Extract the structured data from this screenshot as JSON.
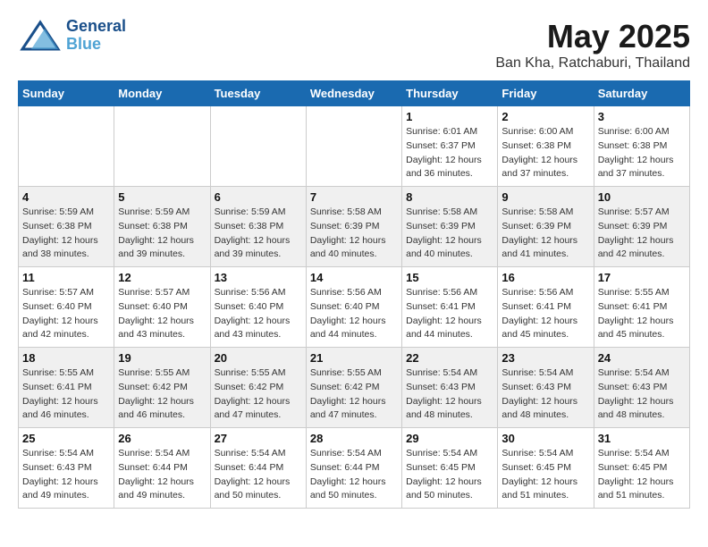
{
  "header": {
    "logo_general": "General",
    "logo_blue": "Blue",
    "title": "May 2025",
    "subtitle": "Ban Kha, Ratchaburi, Thailand"
  },
  "weekdays": [
    "Sunday",
    "Monday",
    "Tuesday",
    "Wednesday",
    "Thursday",
    "Friday",
    "Saturday"
  ],
  "weeks": [
    {
      "row_bg": "light",
      "days": [
        {
          "num": "",
          "info": ""
        },
        {
          "num": "",
          "info": ""
        },
        {
          "num": "",
          "info": ""
        },
        {
          "num": "",
          "info": ""
        },
        {
          "num": "1",
          "info": "Sunrise: 6:01 AM\nSunset: 6:37 PM\nDaylight: 12 hours\nand 36 minutes."
        },
        {
          "num": "2",
          "info": "Sunrise: 6:00 AM\nSunset: 6:38 PM\nDaylight: 12 hours\nand 37 minutes."
        },
        {
          "num": "3",
          "info": "Sunrise: 6:00 AM\nSunset: 6:38 PM\nDaylight: 12 hours\nand 37 minutes."
        }
      ]
    },
    {
      "row_bg": "dark",
      "days": [
        {
          "num": "4",
          "info": "Sunrise: 5:59 AM\nSunset: 6:38 PM\nDaylight: 12 hours\nand 38 minutes."
        },
        {
          "num": "5",
          "info": "Sunrise: 5:59 AM\nSunset: 6:38 PM\nDaylight: 12 hours\nand 39 minutes."
        },
        {
          "num": "6",
          "info": "Sunrise: 5:59 AM\nSunset: 6:38 PM\nDaylight: 12 hours\nand 39 minutes."
        },
        {
          "num": "7",
          "info": "Sunrise: 5:58 AM\nSunset: 6:39 PM\nDaylight: 12 hours\nand 40 minutes."
        },
        {
          "num": "8",
          "info": "Sunrise: 5:58 AM\nSunset: 6:39 PM\nDaylight: 12 hours\nand 40 minutes."
        },
        {
          "num": "9",
          "info": "Sunrise: 5:58 AM\nSunset: 6:39 PM\nDaylight: 12 hours\nand 41 minutes."
        },
        {
          "num": "10",
          "info": "Sunrise: 5:57 AM\nSunset: 6:39 PM\nDaylight: 12 hours\nand 42 minutes."
        }
      ]
    },
    {
      "row_bg": "light",
      "days": [
        {
          "num": "11",
          "info": "Sunrise: 5:57 AM\nSunset: 6:40 PM\nDaylight: 12 hours\nand 42 minutes."
        },
        {
          "num": "12",
          "info": "Sunrise: 5:57 AM\nSunset: 6:40 PM\nDaylight: 12 hours\nand 43 minutes."
        },
        {
          "num": "13",
          "info": "Sunrise: 5:56 AM\nSunset: 6:40 PM\nDaylight: 12 hours\nand 43 minutes."
        },
        {
          "num": "14",
          "info": "Sunrise: 5:56 AM\nSunset: 6:40 PM\nDaylight: 12 hours\nand 44 minutes."
        },
        {
          "num": "15",
          "info": "Sunrise: 5:56 AM\nSunset: 6:41 PM\nDaylight: 12 hours\nand 44 minutes."
        },
        {
          "num": "16",
          "info": "Sunrise: 5:56 AM\nSunset: 6:41 PM\nDaylight: 12 hours\nand 45 minutes."
        },
        {
          "num": "17",
          "info": "Sunrise: 5:55 AM\nSunset: 6:41 PM\nDaylight: 12 hours\nand 45 minutes."
        }
      ]
    },
    {
      "row_bg": "dark",
      "days": [
        {
          "num": "18",
          "info": "Sunrise: 5:55 AM\nSunset: 6:41 PM\nDaylight: 12 hours\nand 46 minutes."
        },
        {
          "num": "19",
          "info": "Sunrise: 5:55 AM\nSunset: 6:42 PM\nDaylight: 12 hours\nand 46 minutes."
        },
        {
          "num": "20",
          "info": "Sunrise: 5:55 AM\nSunset: 6:42 PM\nDaylight: 12 hours\nand 47 minutes."
        },
        {
          "num": "21",
          "info": "Sunrise: 5:55 AM\nSunset: 6:42 PM\nDaylight: 12 hours\nand 47 minutes."
        },
        {
          "num": "22",
          "info": "Sunrise: 5:54 AM\nSunset: 6:43 PM\nDaylight: 12 hours\nand 48 minutes."
        },
        {
          "num": "23",
          "info": "Sunrise: 5:54 AM\nSunset: 6:43 PM\nDaylight: 12 hours\nand 48 minutes."
        },
        {
          "num": "24",
          "info": "Sunrise: 5:54 AM\nSunset: 6:43 PM\nDaylight: 12 hours\nand 48 minutes."
        }
      ]
    },
    {
      "row_bg": "light",
      "days": [
        {
          "num": "25",
          "info": "Sunrise: 5:54 AM\nSunset: 6:43 PM\nDaylight: 12 hours\nand 49 minutes."
        },
        {
          "num": "26",
          "info": "Sunrise: 5:54 AM\nSunset: 6:44 PM\nDaylight: 12 hours\nand 49 minutes."
        },
        {
          "num": "27",
          "info": "Sunrise: 5:54 AM\nSunset: 6:44 PM\nDaylight: 12 hours\nand 50 minutes."
        },
        {
          "num": "28",
          "info": "Sunrise: 5:54 AM\nSunset: 6:44 PM\nDaylight: 12 hours\nand 50 minutes."
        },
        {
          "num": "29",
          "info": "Sunrise: 5:54 AM\nSunset: 6:45 PM\nDaylight: 12 hours\nand 50 minutes."
        },
        {
          "num": "30",
          "info": "Sunrise: 5:54 AM\nSunset: 6:45 PM\nDaylight: 12 hours\nand 51 minutes."
        },
        {
          "num": "31",
          "info": "Sunrise: 5:54 AM\nSunset: 6:45 PM\nDaylight: 12 hours\nand 51 minutes."
        }
      ]
    }
  ]
}
